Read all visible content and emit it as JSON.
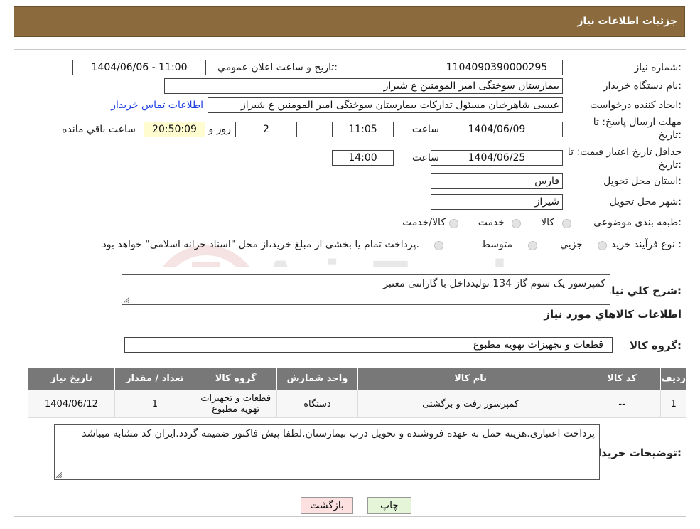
{
  "header": {
    "title": "جزئیات اطلاعات نیاز"
  },
  "need_number": {
    "label": "شماره نیاز:",
    "value": "1104090390000295"
  },
  "announce": {
    "label": "تاریخ و ساعت اعلان عمومي:",
    "value": "1404/06/06 - 11:00"
  },
  "buyer_org": {
    "label": "نام دستگاه خریدار:",
    "value": "بیمارستان سوختگی امیر المومنین  ع  شیراز"
  },
  "requester": {
    "label": "ایجاد کننده درخواست:",
    "value": "عیسی  شاهرخیان مسئول تدارکات بیمارستان سوختگی امیر المومنین  ع  شیراز",
    "contact_link": "اطلاعات تماس خریدار"
  },
  "response_deadline": {
    "label_line1": "مهلت ارسال پاسخ: تا",
    "label_line2": "تاریخ:",
    "date": "1404/06/09",
    "time_label": "ساعت",
    "time": "11:05",
    "days": "2",
    "days_label": "روز و",
    "remaining": "20:50:09",
    "remaining_label": "ساعت باقي مانده"
  },
  "price_validity": {
    "label_line1": "حداقل تاریخ اعتبار قیمت: تا",
    "label_line2": "تاریخ:",
    "date": "1404/06/25",
    "time_label": "ساعت",
    "time": "14:00"
  },
  "province": {
    "label": "استان محل تحویل:",
    "value": "فارس"
  },
  "city": {
    "label": "شهر محل تحویل:",
    "value": "شیراز"
  },
  "category": {
    "label": "طبقه بندی موضوعی:",
    "options": [
      "کالا",
      "خدمت",
      "کالا/خدمت"
    ]
  },
  "purchase_type": {
    "label": "نوع فرآیند خرید :",
    "options": [
      "جزيي",
      "متوسط"
    ],
    "note": "پرداخت تمام یا بخشی از مبلغ خرید،از محل \"اسناد خزانه اسلامی\" خواهد بود."
  },
  "general_desc": {
    "label": "شرح کلي نیاز:",
    "value": "کمپرسور یک سوم گاز 134 تولیدداخل با گارانتی معتبر"
  },
  "goods_info_title": "اطلاعات کالاهاي مورد نیاز",
  "goods_group": {
    "label": "گروه کالا:",
    "value": "قطعات و تجهیزات تهویه مطبوع"
  },
  "table": {
    "headers": [
      "ردیف",
      "کد کالا",
      "نام کالا",
      "واحد شمارش",
      "گروه کالا",
      "تعداد / مقدار",
      "تاریخ نیاز"
    ],
    "rows": [
      [
        "1",
        "--",
        "کمپرسور رفت و برگشتی",
        "دستگاه",
        "قطعات و تجهیزات تهویه مطبوع",
        "1",
        "1404/06/12"
      ]
    ]
  },
  "buyer_notes": {
    "label": "توضیحات خریدار:",
    "value": "پرداخت اعتباری.هزینه حمل به عهده فروشنده و تحویل درب بیمارستان.لطفا پیش فاکتور ضمیمه گردد.ایران کد مشابه میباشد"
  },
  "buttons": {
    "print": "چاپ",
    "back": "بازگشت"
  },
  "colors": {
    "header": "#8b6a3e",
    "table_header": "#787878",
    "link": "#1a3ee0",
    "back_button": "#fde0e0",
    "print_button": "#e4f5d8"
  },
  "watermark": {
    "text": "AriaTender.neT"
  }
}
